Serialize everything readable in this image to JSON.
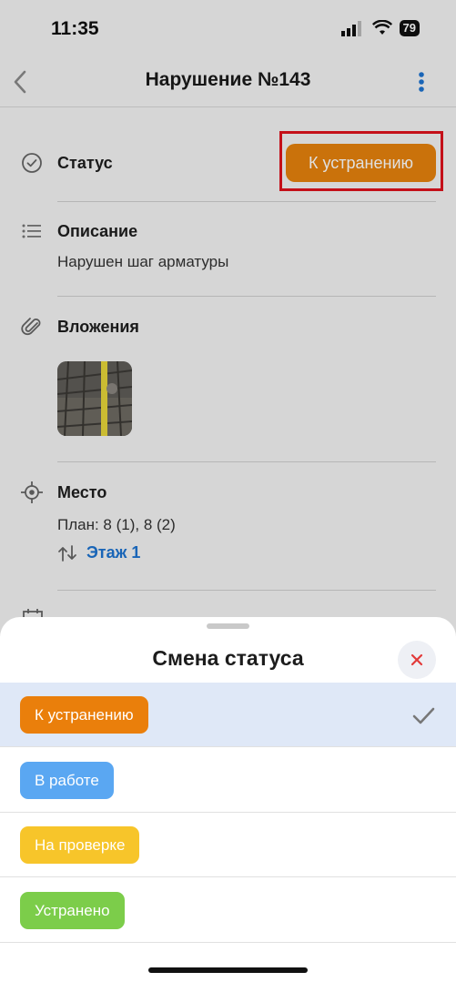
{
  "statusbar": {
    "time": "11:35",
    "battery": "79"
  },
  "nav": {
    "title": "Нарушение №143"
  },
  "status": {
    "label": "Статус",
    "value": "К устранению",
    "value_color": "#e6820d"
  },
  "description": {
    "label": "Описание",
    "text": "Нарушен шаг арматуры"
  },
  "attachments": {
    "label": "Вложения"
  },
  "place": {
    "label": "Место",
    "plan": "План: 8 (1), 8 (2)",
    "floor": "Этаж 1"
  },
  "sheet": {
    "title": "Смена статуса",
    "options": [
      {
        "label": "К устранению",
        "color": "#ea7f0b",
        "selected": true
      },
      {
        "label": "В работе",
        "color": "#5aa7f2",
        "selected": false
      },
      {
        "label": "На проверке",
        "color": "#f7c52a",
        "selected": false
      },
      {
        "label": "Устранено",
        "color": "#7ccd4a",
        "selected": false
      }
    ]
  },
  "colors": {
    "accent_blue": "#1d73d1",
    "highlight_red": "#e0131d",
    "selected_row": "#dfe8f7"
  }
}
